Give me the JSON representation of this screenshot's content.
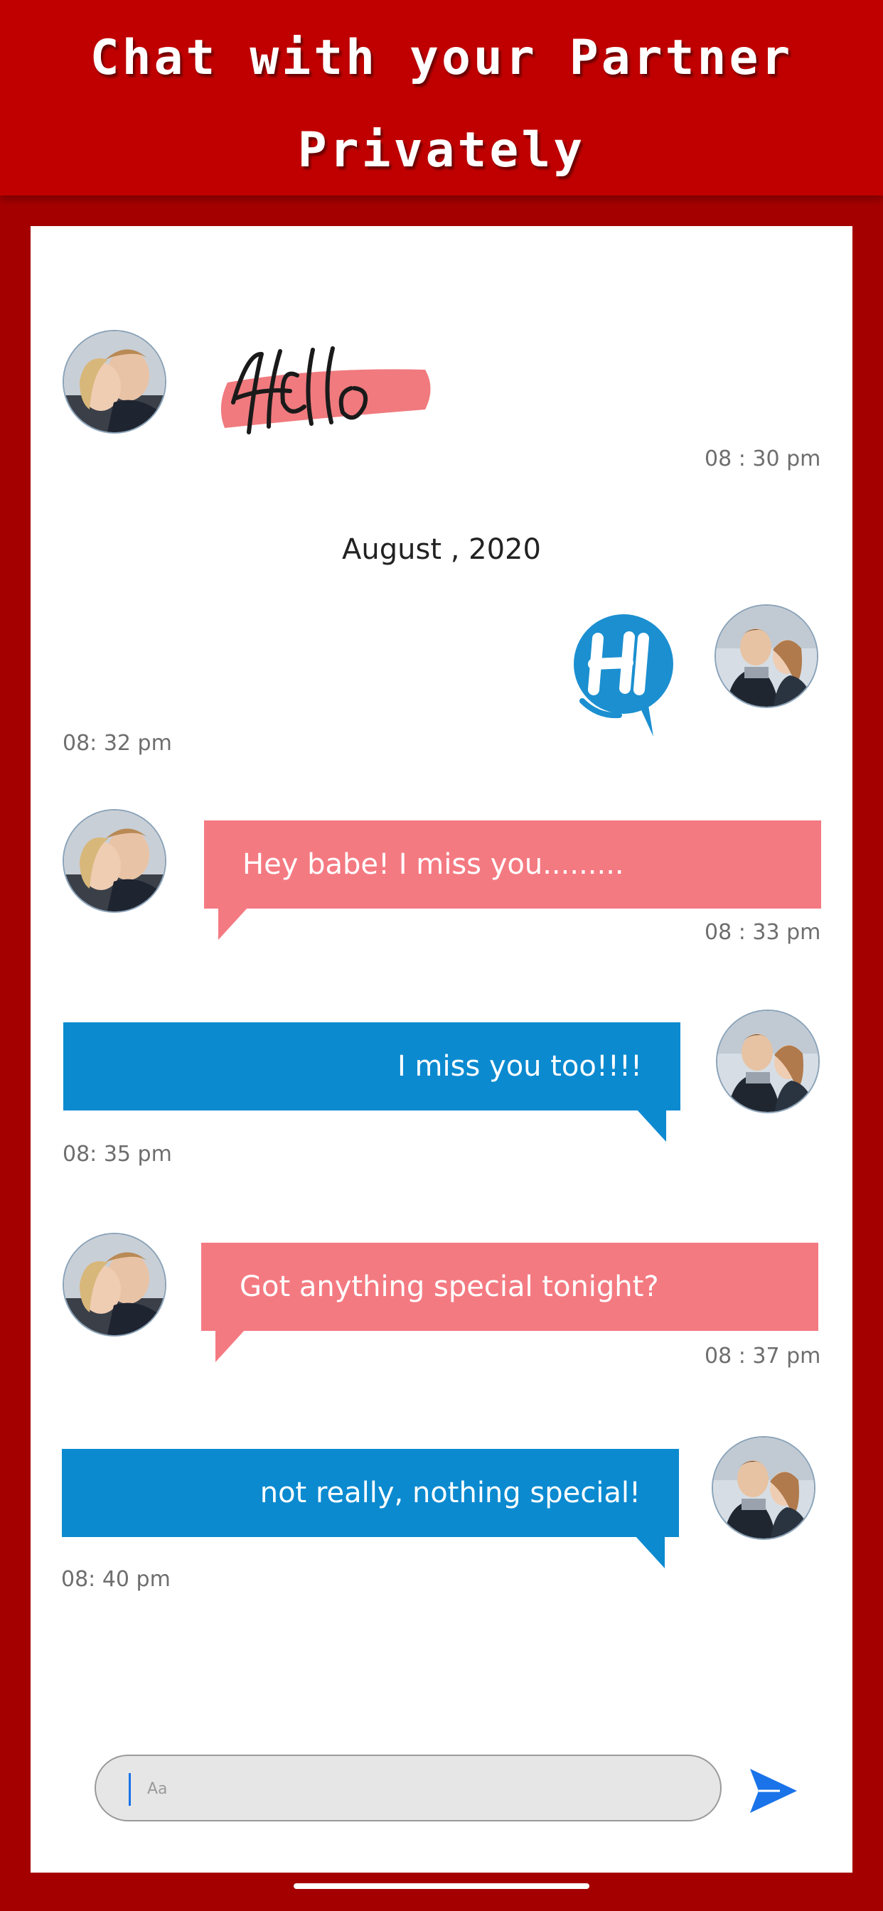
{
  "header": {
    "line1": "Chat with your Partner",
    "line2": "Privately"
  },
  "messages": [
    {
      "id": 1,
      "side": "left",
      "kind": "sticker",
      "sticker": "hello-sticker",
      "time": "08 : 30 pm"
    },
    {
      "id": 2,
      "side": "right",
      "kind": "sticker",
      "sticker": "hi-speech-sticker",
      "time": "08: 32 pm"
    },
    {
      "id": 3,
      "side": "left",
      "kind": "text",
      "text": "Hey babe! I miss you.........",
      "time": "08 : 33 pm"
    },
    {
      "id": 4,
      "side": "right",
      "kind": "text",
      "text": "I miss you too!!!!",
      "time": "08: 35 pm"
    },
    {
      "id": 5,
      "side": "left",
      "kind": "text",
      "text": "Got anything special tonight?",
      "time": "08 : 37 pm"
    },
    {
      "id": 6,
      "side": "right",
      "kind": "text",
      "text": "not really, nothing special!",
      "time": "08: 40 pm"
    }
  ],
  "date_separator": "August , 2020",
  "composer": {
    "placeholder": "Aa",
    "send_icon": "send-icon"
  },
  "colors": {
    "header_bg": "#c00000",
    "frame_bg": "#a50000",
    "incoming_bubble": "#f47a82",
    "outgoing_bubble": "#0b8ad0",
    "send_icon": "#1a73e8"
  }
}
